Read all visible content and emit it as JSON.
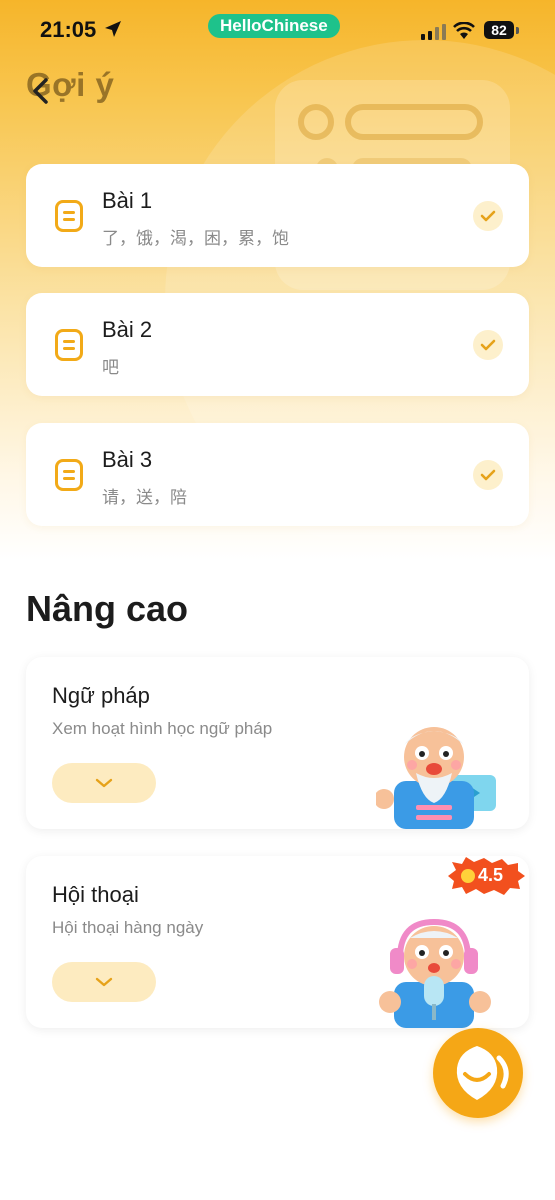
{
  "status_bar": {
    "time": "21:05",
    "app_badge": "HelloChinese",
    "battery": "82"
  },
  "header": {
    "title": "Gợi ý"
  },
  "lessons": [
    {
      "title": "Bài 1",
      "words": "了，饿，渴，困，累，饱"
    },
    {
      "title": "Bài 2",
      "words": "吧"
    },
    {
      "title": "Bài 3",
      "words": "请，送，陪"
    }
  ],
  "advanced": {
    "title": "Nâng cao",
    "cards": [
      {
        "title": "Ngữ pháp",
        "subtitle": "Xem hoạt hình học ngữ pháp",
        "character": "teacher-video"
      },
      {
        "title": "Hội thoại",
        "subtitle": "Hội thoại hàng ngày",
        "character": "teacher-headphones",
        "rating": "4.5"
      }
    ]
  },
  "colors": {
    "accent": "#f5a716",
    "badge_green": "#1ec28b",
    "rating_red": "#f2501e"
  }
}
